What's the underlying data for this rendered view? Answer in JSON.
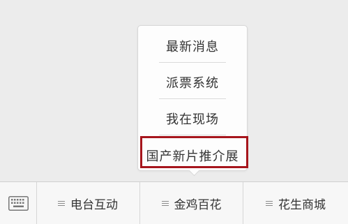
{
  "popup_menu": {
    "items": [
      {
        "label": "最新消息"
      },
      {
        "label": "派票系统"
      },
      {
        "label": "我在现场"
      },
      {
        "label": "国产新片推介展"
      }
    ]
  },
  "tab_bar": {
    "keyboard_icon": "keyboard-icon",
    "menu_icon": "menu-icon",
    "tabs": [
      {
        "label": "电台互动"
      },
      {
        "label": "金鸡百花"
      },
      {
        "label": "花生商城"
      }
    ]
  },
  "colors": {
    "highlight_border": "#a6151c",
    "background": "#ececec",
    "popup_background": "#fdfdfd"
  }
}
